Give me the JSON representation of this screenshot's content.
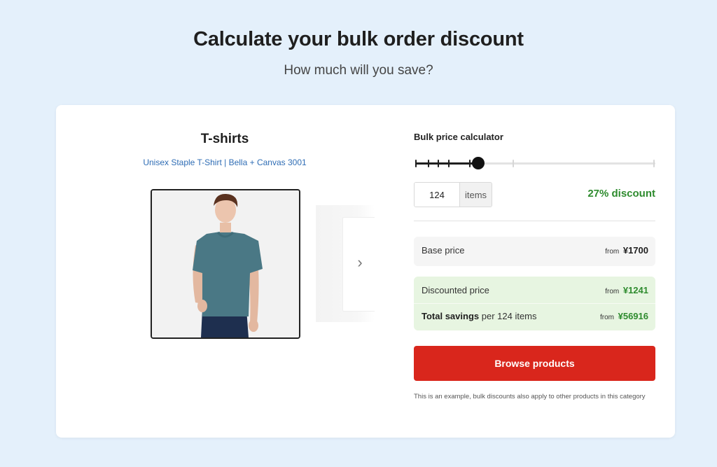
{
  "header": {
    "title": "Calculate your bulk order discount",
    "subtitle": "How much will you save?"
  },
  "product": {
    "title": "T-shirts",
    "link": "Unisex Staple T-Shirt | Bella + Canvas 3001",
    "shirt_color": "#4a7885",
    "jeans_color": "#1e2f4f"
  },
  "calculator": {
    "label": "Bulk price calculator",
    "slider_ticks": [
      {
        "position": 0.0,
        "filled": true
      },
      {
        "position": 0.052,
        "filled": true
      },
      {
        "position": 0.095,
        "filled": true
      },
      {
        "position": 0.138,
        "filled": true
      },
      {
        "position": 0.225,
        "filled": true
      },
      {
        "position": 0.41,
        "filled": false
      },
      {
        "position": 1.0,
        "filled": false
      }
    ],
    "slider_value": 0.262,
    "quantity": "124",
    "quantity_unit": "items",
    "discount": "27% discount"
  },
  "prices": {
    "base_label": "Base price",
    "base_from": "from",
    "base_value": "¥1700",
    "discounted_label": "Discounted price",
    "discounted_from": "from",
    "discounted_value": "¥1241",
    "savings_label_bold": "Total savings",
    "savings_label_rest": " per 124 items",
    "savings_from": "from",
    "savings_value": "¥56916"
  },
  "actions": {
    "browse_label": "Browse products"
  },
  "footnote": "This is an example, bulk discounts also apply to other products in this category",
  "colors": {
    "accent_red": "#d9261c",
    "discount_green": "#2e8b2e",
    "link_blue": "#2f6db5",
    "background": "#e4f0fb"
  },
  "icons": {
    "next": "chevron-right-icon"
  }
}
